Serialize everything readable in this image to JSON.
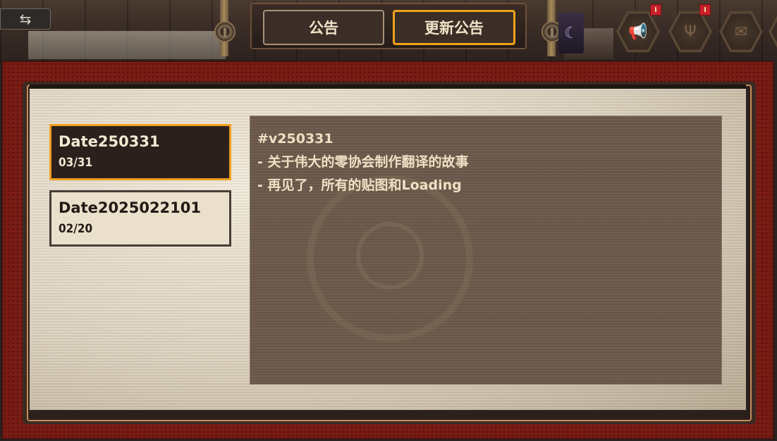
{
  "tabs": {
    "notice_label": "公告",
    "update_label": "更新公告"
  },
  "icons": {
    "back": "swap-arrows-icon",
    "moon": "moon-icon",
    "megaphone": "megaphone-icon",
    "trident": "trident-icon",
    "mail": "mail-icon"
  },
  "colors": {
    "accent": "#f2a11b",
    "badge": "#c8202a",
    "frame": "#7a1c14"
  },
  "list": {
    "items": [
      {
        "title": "Date250331",
        "date": "03/31",
        "selected": true
      },
      {
        "title": "Date2025022101",
        "date": "02/20",
        "selected": false
      }
    ]
  },
  "content": {
    "lines": [
      "#v250331",
      "- 关于伟大的零协会制作翻译的故事",
      "- 再见了，所有的贴图和Loading"
    ]
  }
}
